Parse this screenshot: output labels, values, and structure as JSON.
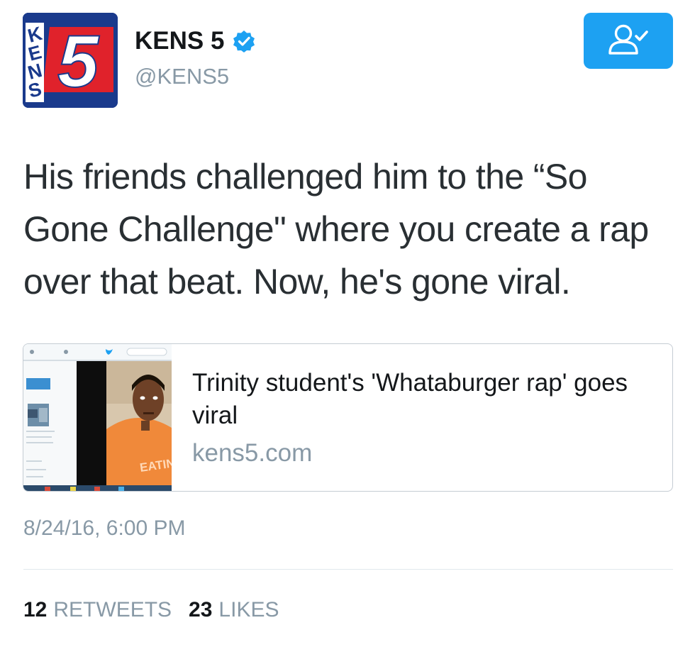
{
  "account": {
    "display_name": "KENS 5",
    "handle": "@KENS5",
    "verified": true,
    "avatar_logo_letters": "KENS",
    "avatar_logo_number": "5"
  },
  "follow_button": {
    "icon": "person-check-icon",
    "color": "#1da1f2"
  },
  "tweet": {
    "text": "His friends challenged him to the “So Gone Challenge\" where you create a rap over that beat. Now, he's gone viral.",
    "timestamp": "8/24/16, 6:00 PM"
  },
  "card": {
    "title": "Trinity student's 'Whataburger rap' goes viral",
    "domain": "kens5.com"
  },
  "stats": {
    "retweets_count": "12",
    "retweets_label": "RETWEETS",
    "likes_count": "23",
    "likes_label": "LIKES"
  },
  "colors": {
    "accent": "#1da1f2",
    "secondary_text": "#8899a6",
    "logo_blue": "#1a3a8c",
    "logo_red": "#e0222b"
  }
}
